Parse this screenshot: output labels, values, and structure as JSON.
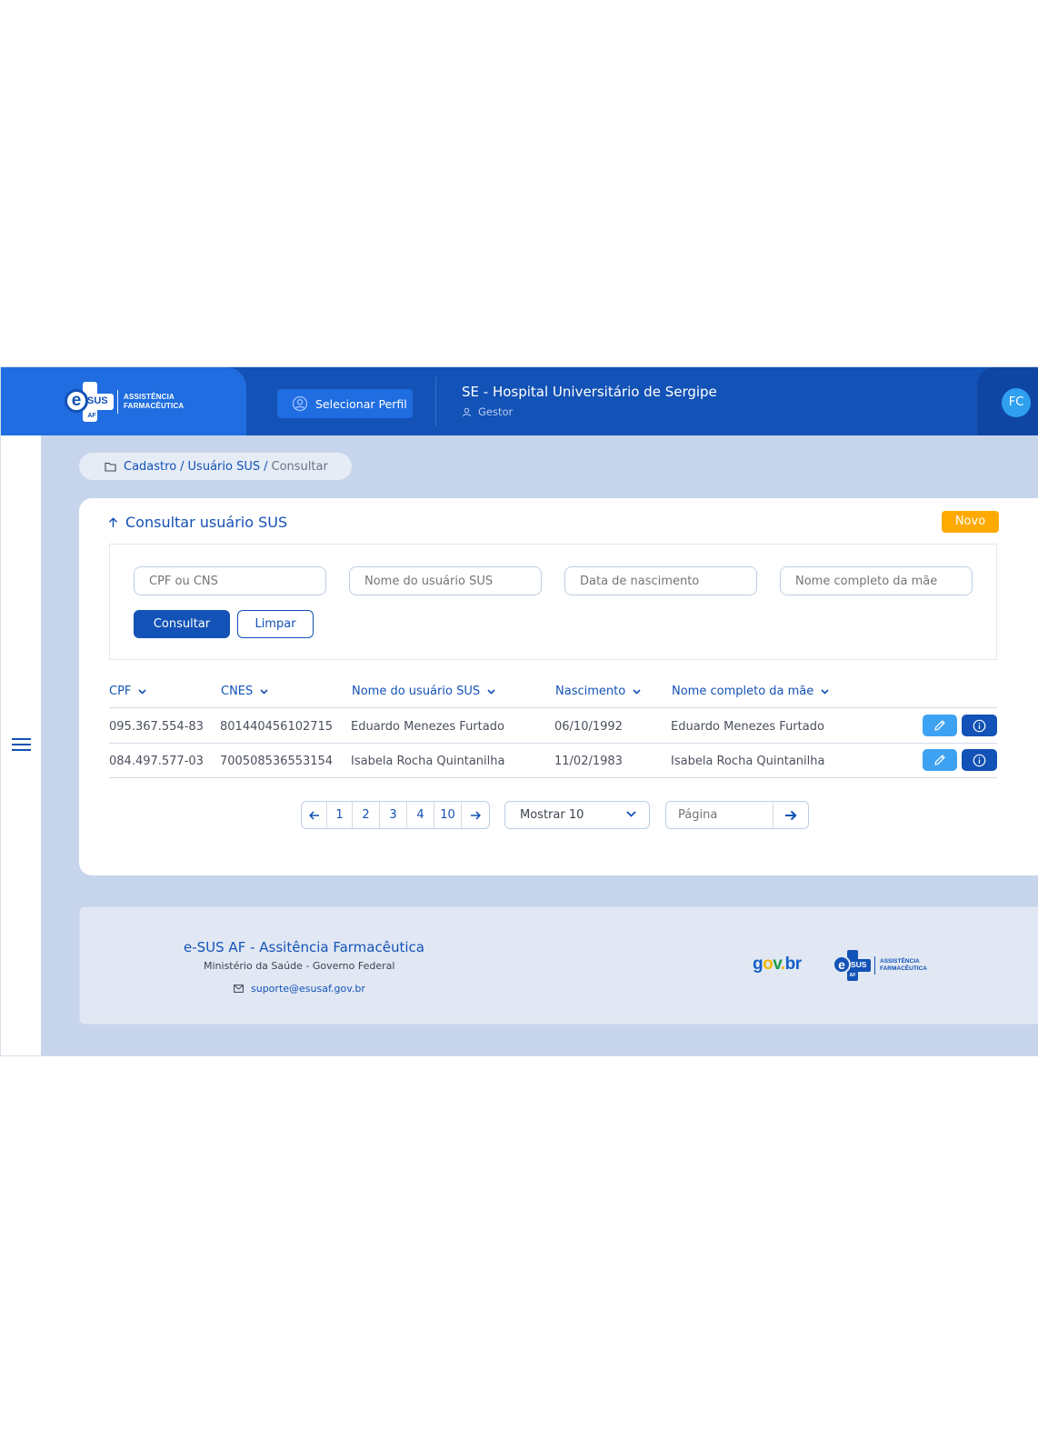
{
  "header": {
    "brand_line1": "ASSISTÊNCIA",
    "brand_line2": "FARMACÊUTICA",
    "logo_sus": "SUS",
    "logo_af": "AF",
    "logo_e": "e",
    "profile_button": "Selecionar Perfil",
    "hospital_name": "SE - Hospital Universitário de Sergipe",
    "role": "Gestor",
    "avatar_initials": "FC"
  },
  "breadcrumb": {
    "items": [
      "Cadastro",
      "Usuário SUS"
    ],
    "separator": "/",
    "current": "Consultar"
  },
  "card": {
    "title": "Consultar usuário SUS",
    "new_button": "Novo",
    "filters": {
      "cpf_placeholder": "CPF ou CNS",
      "name_placeholder": "Nome do usuário SUS",
      "birth_placeholder": "Data de nascimento",
      "mother_placeholder": "Nome completo da mãe"
    },
    "search_button": "Consultar",
    "clear_button": "Limpar"
  },
  "table": {
    "columns": [
      "CPF",
      "CNES",
      "Nome do usuário SUS",
      "Nascimento",
      "Nome completo da mãe"
    ],
    "rows": [
      [
        "095.367.554-83",
        "801440456102715",
        "Eduardo Menezes Furtado",
        "06/10/1992",
        "Eduardo Menezes Furtado"
      ],
      [
        "084.497.577-03",
        "700508536553154",
        "Isabela Rocha Quintanilha",
        "11/02/1983",
        "Isabela Rocha Quintanilha"
      ]
    ]
  },
  "pagination": {
    "pages": [
      "1",
      "2",
      "3",
      "4",
      "10"
    ],
    "page_size": "Mostrar 10",
    "page_placeholder": "Página"
  },
  "footer": {
    "title": "e-SUS AF - Assitência Farmacêutica",
    "subtitle": "Ministério da Saúde - Governo Federal",
    "email": "suporte@esusaf.gov.br",
    "govbr_g": "g",
    "govbr_o": "o",
    "govbr_v": "v",
    "govbr_dot": ".",
    "govbr_br": "br"
  },
  "colors": {
    "primary": "#1352b6",
    "brand_panel": "#1f6de0",
    "background": "#c6d5eb",
    "accent_orange": "#ffaa00",
    "edit_button": "#3ea2f2"
  },
  "icons": {
    "profile": "user-circle-icon",
    "role": "user-icon",
    "menu": "hamburger-icon",
    "breadcrumb": "folder-icon",
    "title": "arrow-up-icon",
    "sort": "chevron-down-icon",
    "edit": "pencil-icon",
    "info": "info-icon",
    "prev": "arrow-left-icon",
    "next": "arrow-right-icon",
    "mail": "mail-icon"
  }
}
